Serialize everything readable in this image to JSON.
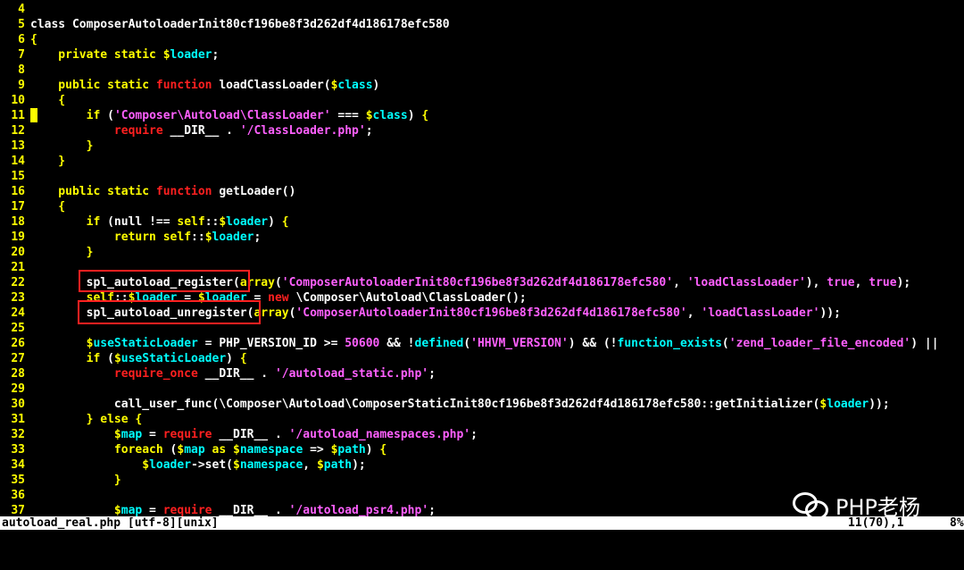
{
  "colors": {
    "line_number": "#ffff00",
    "plain": "#ffffff",
    "keyword": "#ffff00",
    "function_kw": "#ff2020",
    "string": "#ff60ff",
    "variable_sigil": "#ffff00",
    "variable_name": "#00ffff",
    "number": "#ff60ff",
    "statusbar_bg": "#ffffff",
    "statusbar_fg": "#000000",
    "highlight_box": "#ff2020"
  },
  "lines": [
    {
      "n": "4",
      "tokens": []
    },
    {
      "n": "5",
      "tokens": [
        {
          "t": "class ComposerAutoloaderInit80cf196be8f3d262df4d186178efc580",
          "c": "plain"
        }
      ]
    },
    {
      "n": "6",
      "tokens": [
        {
          "t": "{",
          "c": "keyword"
        }
      ]
    },
    {
      "n": "7",
      "tokens": [
        {
          "t": "    private static ",
          "c": "keyword"
        },
        {
          "t": "$",
          "c": "variable_sigil"
        },
        {
          "t": "loader",
          "c": "variable_name"
        },
        {
          "t": ";",
          "c": "plain"
        }
      ]
    },
    {
      "n": "8",
      "tokens": []
    },
    {
      "n": "9",
      "tokens": [
        {
          "t": "    public static ",
          "c": "keyword"
        },
        {
          "t": "function",
          "c": "function_kw"
        },
        {
          "t": " loadClassLoader(",
          "c": "plain"
        },
        {
          "t": "$",
          "c": "variable_sigil"
        },
        {
          "t": "class",
          "c": "variable_name"
        },
        {
          "t": ")",
          "c": "plain"
        }
      ]
    },
    {
      "n": "10",
      "tokens": [
        {
          "t": "    {",
          "c": "keyword"
        }
      ]
    },
    {
      "n": "11",
      "tokens": [
        {
          "t": "        if",
          "c": "keyword"
        },
        {
          "t": " (",
          "c": "plain"
        },
        {
          "t": "'Composer\\Autoload\\ClassLoader'",
          "c": "string"
        },
        {
          "t": " === ",
          "c": "plain"
        },
        {
          "t": "$",
          "c": "variable_sigil"
        },
        {
          "t": "class",
          "c": "variable_name"
        },
        {
          "t": ") ",
          "c": "plain"
        },
        {
          "t": "{",
          "c": "keyword"
        }
      ]
    },
    {
      "n": "12",
      "tokens": [
        {
          "t": "            require",
          "c": "function_kw"
        },
        {
          "t": " __DIR__ . ",
          "c": "plain"
        },
        {
          "t": "'/ClassLoader.php'",
          "c": "string"
        },
        {
          "t": ";",
          "c": "plain"
        }
      ]
    },
    {
      "n": "13",
      "tokens": [
        {
          "t": "        }",
          "c": "keyword"
        }
      ]
    },
    {
      "n": "14",
      "tokens": [
        {
          "t": "    }",
          "c": "keyword"
        }
      ]
    },
    {
      "n": "15",
      "tokens": []
    },
    {
      "n": "16",
      "tokens": [
        {
          "t": "    public static ",
          "c": "keyword"
        },
        {
          "t": "function",
          "c": "function_kw"
        },
        {
          "t": " getLoader()",
          "c": "plain"
        }
      ]
    },
    {
      "n": "17",
      "tokens": [
        {
          "t": "    {",
          "c": "keyword"
        }
      ]
    },
    {
      "n": "18",
      "tokens": [
        {
          "t": "        if",
          "c": "keyword"
        },
        {
          "t": " (null !== ",
          "c": "plain"
        },
        {
          "t": "self",
          "c": "keyword"
        },
        {
          "t": "::",
          "c": "plain"
        },
        {
          "t": "$",
          "c": "variable_sigil"
        },
        {
          "t": "loader",
          "c": "variable_name"
        },
        {
          "t": ") ",
          "c": "plain"
        },
        {
          "t": "{",
          "c": "keyword"
        }
      ]
    },
    {
      "n": "19",
      "tokens": [
        {
          "t": "            return",
          "c": "keyword"
        },
        {
          "t": " ",
          "c": "plain"
        },
        {
          "t": "self",
          "c": "keyword"
        },
        {
          "t": "::",
          "c": "plain"
        },
        {
          "t": "$",
          "c": "variable_sigil"
        },
        {
          "t": "loader",
          "c": "variable_name"
        },
        {
          "t": ";",
          "c": "plain"
        }
      ]
    },
    {
      "n": "20",
      "tokens": [
        {
          "t": "        }",
          "c": "keyword"
        }
      ]
    },
    {
      "n": "21",
      "tokens": []
    },
    {
      "n": "22",
      "tokens": [
        {
          "t": "        spl_autoload_register(",
          "c": "plain"
        },
        {
          "t": "array",
          "c": "keyword"
        },
        {
          "t": "(",
          "c": "plain"
        },
        {
          "t": "'ComposerAutoloaderInit80cf196be8f3d262df4d186178efc580'",
          "c": "string"
        },
        {
          "t": ", ",
          "c": "plain"
        },
        {
          "t": "'loadClassLoader'",
          "c": "string"
        },
        {
          "t": "), ",
          "c": "plain"
        },
        {
          "t": "true",
          "c": "string"
        },
        {
          "t": ", ",
          "c": "plain"
        },
        {
          "t": "true",
          "c": "string"
        },
        {
          "t": ");",
          "c": "plain"
        }
      ]
    },
    {
      "n": "23",
      "tokens": [
        {
          "t": "        ",
          "c": "plain"
        },
        {
          "t": "self",
          "c": "keyword"
        },
        {
          "t": "::",
          "c": "plain"
        },
        {
          "t": "$",
          "c": "variable_sigil"
        },
        {
          "t": "loader",
          "c": "variable_name"
        },
        {
          "t": " = ",
          "c": "plain"
        },
        {
          "t": "$",
          "c": "variable_sigil"
        },
        {
          "t": "loader",
          "c": "variable_name"
        },
        {
          "t": " = ",
          "c": "plain"
        },
        {
          "t": "new",
          "c": "function_kw"
        },
        {
          "t": " \\Composer\\Autoload\\ClassLoader();",
          "c": "plain"
        }
      ]
    },
    {
      "n": "24",
      "tokens": [
        {
          "t": "        spl_autoload_unregister(",
          "c": "plain"
        },
        {
          "t": "array",
          "c": "keyword"
        },
        {
          "t": "(",
          "c": "plain"
        },
        {
          "t": "'ComposerAutoloaderInit80cf196be8f3d262df4d186178efc580'",
          "c": "string"
        },
        {
          "t": ", ",
          "c": "plain"
        },
        {
          "t": "'loadClassLoader'",
          "c": "string"
        },
        {
          "t": "));",
          "c": "plain"
        }
      ]
    },
    {
      "n": "25",
      "tokens": []
    },
    {
      "n": "26",
      "tokens": [
        {
          "t": "        ",
          "c": "plain"
        },
        {
          "t": "$",
          "c": "variable_sigil"
        },
        {
          "t": "useStaticLoader",
          "c": "variable_name"
        },
        {
          "t": " = PHP_VERSION_ID >= ",
          "c": "plain"
        },
        {
          "t": "50600",
          "c": "number"
        },
        {
          "t": " && !",
          "c": "plain"
        },
        {
          "t": "defined",
          "c": "variable_name"
        },
        {
          "t": "(",
          "c": "plain"
        },
        {
          "t": "'HHVM_VERSION'",
          "c": "string"
        },
        {
          "t": ") && (!",
          "c": "plain"
        },
        {
          "t": "function_exists",
          "c": "variable_name"
        },
        {
          "t": "(",
          "c": "plain"
        },
        {
          "t": "'zend_loader_file_encoded'",
          "c": "string"
        },
        {
          "t": ") ||",
          "c": "plain"
        }
      ]
    },
    {
      "n": "27",
      "tokens": [
        {
          "t": "        if",
          "c": "keyword"
        },
        {
          "t": " (",
          "c": "plain"
        },
        {
          "t": "$",
          "c": "variable_sigil"
        },
        {
          "t": "useStaticLoader",
          "c": "variable_name"
        },
        {
          "t": ") ",
          "c": "plain"
        },
        {
          "t": "{",
          "c": "keyword"
        }
      ]
    },
    {
      "n": "28",
      "tokens": [
        {
          "t": "            require_once",
          "c": "function_kw"
        },
        {
          "t": " __DIR__ . ",
          "c": "plain"
        },
        {
          "t": "'/autoload_static.php'",
          "c": "string"
        },
        {
          "t": ";",
          "c": "plain"
        }
      ]
    },
    {
      "n": "29",
      "tokens": []
    },
    {
      "n": "30",
      "tokens": [
        {
          "t": "            call_user_func(\\Composer\\Autoload\\ComposerStaticInit80cf196be8f3d262df4d186178efc580::getInitializer(",
          "c": "plain"
        },
        {
          "t": "$",
          "c": "variable_sigil"
        },
        {
          "t": "loader",
          "c": "variable_name"
        },
        {
          "t": "));",
          "c": "plain"
        }
      ]
    },
    {
      "n": "31",
      "tokens": [
        {
          "t": "        } else {",
          "c": "keyword"
        }
      ]
    },
    {
      "n": "32",
      "tokens": [
        {
          "t": "            ",
          "c": "plain"
        },
        {
          "t": "$",
          "c": "variable_sigil"
        },
        {
          "t": "map",
          "c": "variable_name"
        },
        {
          "t": " = ",
          "c": "plain"
        },
        {
          "t": "require",
          "c": "function_kw"
        },
        {
          "t": " __DIR__ . ",
          "c": "plain"
        },
        {
          "t": "'/autoload_namespaces.php'",
          "c": "string"
        },
        {
          "t": ";",
          "c": "plain"
        }
      ]
    },
    {
      "n": "33",
      "tokens": [
        {
          "t": "            foreach",
          "c": "keyword"
        },
        {
          "t": " (",
          "c": "plain"
        },
        {
          "t": "$",
          "c": "variable_sigil"
        },
        {
          "t": "map",
          "c": "variable_name"
        },
        {
          "t": " as ",
          "c": "keyword"
        },
        {
          "t": "$",
          "c": "variable_sigil"
        },
        {
          "t": "namespace",
          "c": "variable_name"
        },
        {
          "t": " => ",
          "c": "plain"
        },
        {
          "t": "$",
          "c": "variable_sigil"
        },
        {
          "t": "path",
          "c": "variable_name"
        },
        {
          "t": ") ",
          "c": "plain"
        },
        {
          "t": "{",
          "c": "keyword"
        }
      ]
    },
    {
      "n": "34",
      "tokens": [
        {
          "t": "                ",
          "c": "plain"
        },
        {
          "t": "$",
          "c": "variable_sigil"
        },
        {
          "t": "loader",
          "c": "variable_name"
        },
        {
          "t": "->set(",
          "c": "plain"
        },
        {
          "t": "$",
          "c": "variable_sigil"
        },
        {
          "t": "namespace",
          "c": "variable_name"
        },
        {
          "t": ", ",
          "c": "plain"
        },
        {
          "t": "$",
          "c": "variable_sigil"
        },
        {
          "t": "path",
          "c": "variable_name"
        },
        {
          "t": ");",
          "c": "plain"
        }
      ]
    },
    {
      "n": "35",
      "tokens": [
        {
          "t": "            }",
          "c": "keyword"
        }
      ]
    },
    {
      "n": "36",
      "tokens": []
    },
    {
      "n": "37",
      "tokens": [
        {
          "t": "            ",
          "c": "plain"
        },
        {
          "t": "$",
          "c": "variable_sigil"
        },
        {
          "t": "map",
          "c": "variable_name"
        },
        {
          "t": " = ",
          "c": "plain"
        },
        {
          "t": "require",
          "c": "function_kw"
        },
        {
          "t": " __DIR__ . ",
          "c": "plain"
        },
        {
          "t": "'/autoload_psr4.php'",
          "c": "string"
        },
        {
          "t": ";",
          "c": "plain"
        }
      ]
    }
  ],
  "status_bar": {
    "file_info": "autoload_real.php [utf-8][unix]",
    "position": "11(70),1",
    "percent": "8%"
  },
  "watermark": {
    "icon": "wechat-icon",
    "text": "PHP老杨"
  }
}
